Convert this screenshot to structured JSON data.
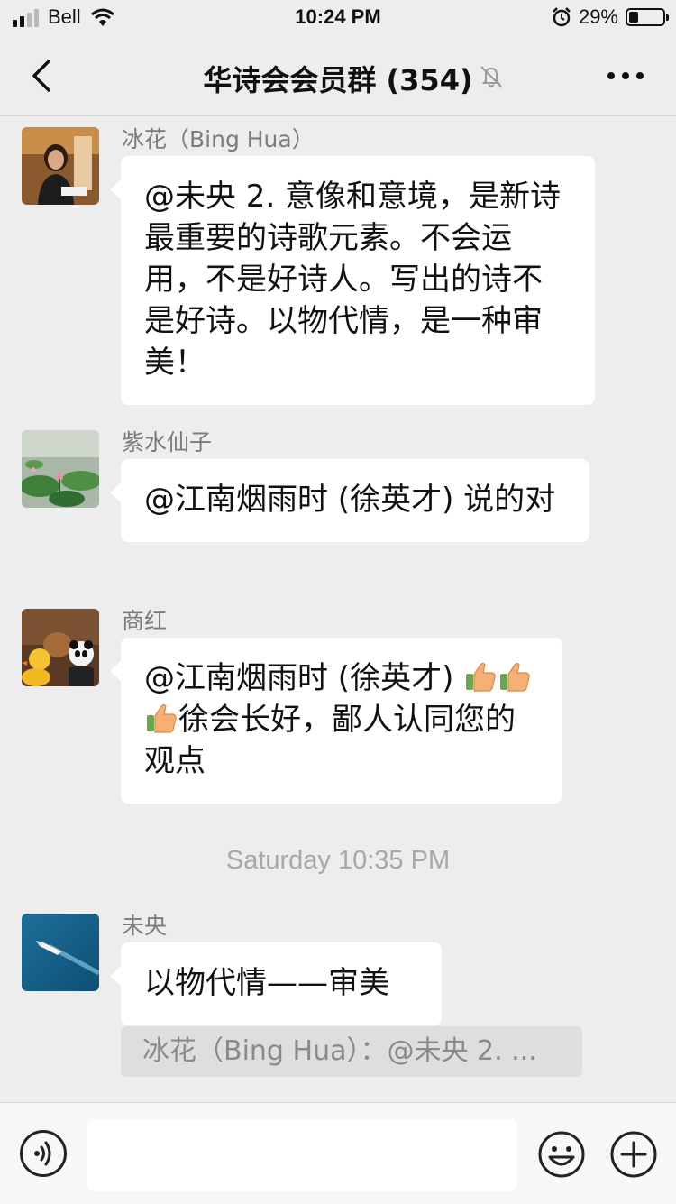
{
  "status_bar": {
    "carrier": "Bell",
    "time": "10:24 PM",
    "battery_percent": "29%",
    "battery_level": 0.29
  },
  "nav": {
    "title": "华诗会会员群 (354)",
    "back_icon": "chevron-left-icon",
    "mute_icon": "bell-slash-icon",
    "more_icon": "ellipsis-icon"
  },
  "messages": [
    {
      "sender": "冰花（Bing Hua）",
      "avatar": "woman-photo",
      "text": "@未央 2. 意像和意境，是新诗最重要的诗歌元素。不会运用，不是好诗人。写出的诗不是好诗。以物代情，是一种审美！"
    },
    {
      "sender": "紫水仙子",
      "avatar": "lotus-photo",
      "text": "@江南烟雨时 (徐英才) 说的对"
    },
    {
      "sender": "商红",
      "avatar": "toys-photo",
      "text_before": "@江南烟雨时 (徐英才) ",
      "emoji": "thumbs-up-icon",
      "emoji_count": 3,
      "text_after": "徐会长好，鄙人认同您的观点"
    },
    {
      "sender": "未央",
      "avatar": "boat-photo",
      "text": "以物代情——审美",
      "quote": "冰花（Bing Hua）：@未央 2. ..."
    }
  ],
  "timestamp": "Saturday 10:35 PM",
  "input_bar": {
    "voice_icon": "voice-icon",
    "emoji_icon": "smiley-icon",
    "plus_icon": "plus-circle-icon",
    "input_value": ""
  }
}
